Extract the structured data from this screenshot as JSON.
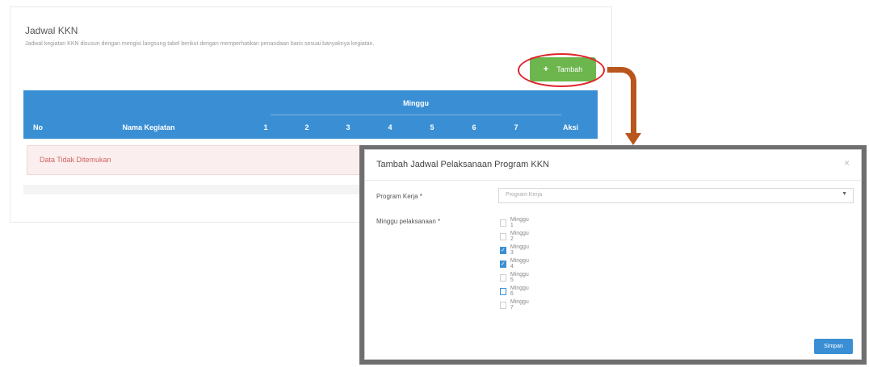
{
  "card": {
    "title": "Jadwal KKN",
    "description": "Jadwal kegiatan KKN disusun dengan mengisi langsung tabel berikut dengan memperhatikan penandaan baris sesuai banyaknya kegiatan."
  },
  "add_button": {
    "icon": "plus-icon",
    "label": "Tambah"
  },
  "table": {
    "group_header": "Minggu",
    "col_no": "No",
    "col_name": "Nama Kegiatan",
    "weeks": [
      "1",
      "2",
      "3",
      "4",
      "5",
      "6",
      "7"
    ],
    "col_action": "Aksi",
    "empty_message": "Data Tidak Ditemukan"
  },
  "modal": {
    "title": "Tambah Jadwal Pelaksanaan Program KKN",
    "close": "×",
    "program_label": "Program Kerja *",
    "program_placeholder": "Program Kerja",
    "week_label": "Minggu pelaksanaan *",
    "week_options": [
      {
        "label": "Minggu 1",
        "checked": false
      },
      {
        "label": "Minggu 2",
        "checked": false
      },
      {
        "label": "Minggu 3",
        "checked": true
      },
      {
        "label": "Minggu 4",
        "checked": true
      },
      {
        "label": "Minggu 5",
        "checked": false
      },
      {
        "label": "Minggu 6",
        "checked": false,
        "focused": true
      },
      {
        "label": "Minggu 7",
        "checked": false
      }
    ],
    "save_label": "Simpan"
  },
  "colors": {
    "header_blue": "#3a8fd4",
    "button_green": "#6cb64d",
    "annotation_red": "#e0242c",
    "annotation_arrow": "#b9561e"
  }
}
